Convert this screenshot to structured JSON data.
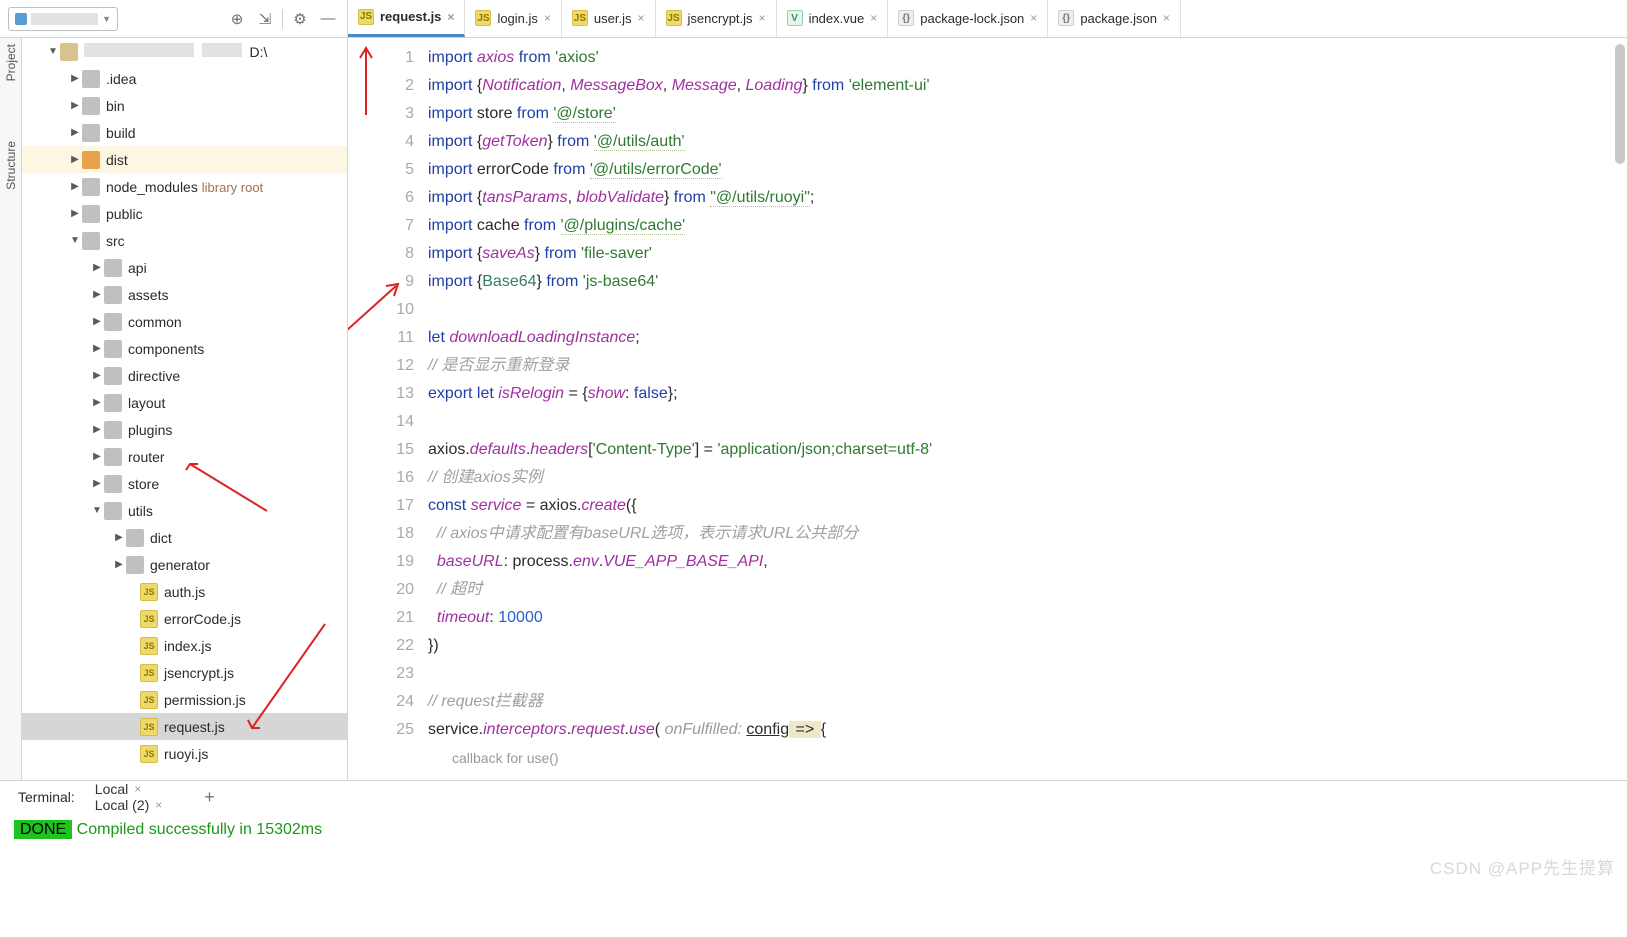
{
  "tabs": [
    {
      "name": "request.js",
      "type": "js",
      "active": true
    },
    {
      "name": "login.js",
      "type": "js"
    },
    {
      "name": "user.js",
      "type": "js"
    },
    {
      "name": "jsencrypt.js",
      "type": "js"
    },
    {
      "name": "index.vue",
      "type": "vue"
    },
    {
      "name": "package-lock.json",
      "type": "json"
    },
    {
      "name": "package.json",
      "type": "json"
    }
  ],
  "sideTabs": {
    "t0": "Project",
    "t1": "Structure"
  },
  "tree": {
    "root_suffix": "D:\\",
    "idea": ".idea",
    "bin": "bin",
    "build": "build",
    "dist": "dist",
    "node_modules": "node_modules",
    "node_modules_lib": "library root",
    "public": "public",
    "src": "src",
    "api": "api",
    "assets": "assets",
    "common": "common",
    "components": "components",
    "directive": "directive",
    "layout": "layout",
    "plugins": "plugins",
    "router": "router",
    "store": "store",
    "utils": "utils",
    "dict": "dict",
    "generator": "generator",
    "auth": "auth.js",
    "errorCode": "errorCode.js",
    "index": "index.js",
    "jsencrypt": "jsencrypt.js",
    "permission": "permission.js",
    "request": "request.js",
    "ruoyi": "ruoyi.js"
  },
  "code": {
    "lines": {
      "start": 1,
      "end": 25
    },
    "l1": {
      "a": "import ",
      "b": "axios",
      "c": " from ",
      "d": "'axios'"
    },
    "l2": {
      "a": "import ",
      "b": "{",
      "c": "Notification",
      "d": ", ",
      "e": "MessageBox",
      "f": ", ",
      "g": "Message",
      "h": ", ",
      "i": "Loading",
      "j": "} ",
      "k": "from ",
      "l": "'element-ui'"
    },
    "l3": {
      "a": "import ",
      "b": "store ",
      "c": "from ",
      "d": "'@/store'"
    },
    "l4": {
      "a": "import ",
      "b": "{",
      "c": "getToken",
      "d": "} ",
      "e": "from ",
      "f": "'@/utils/auth'"
    },
    "l5": {
      "a": "import ",
      "b": "errorCode ",
      "c": "from ",
      "d": "'@/utils/errorCode'"
    },
    "l6": {
      "a": "import ",
      "b": "{",
      "c": "tansParams",
      "d": ", ",
      "e": "blobValidate",
      "f": "} ",
      "g": "from ",
      "h": "\"@/utils/ruoyi\"",
      "i": ";"
    },
    "l7": {
      "a": "import ",
      "b": "cache ",
      "c": "from ",
      "d": "'@/plugins/cache'"
    },
    "l8": {
      "a": "import ",
      "b": "{",
      "c": "saveAs",
      "d": "} ",
      "e": "from ",
      "f": "'file-saver'"
    },
    "l9": {
      "a": "import ",
      "b": "{",
      "c": "Base64",
      "d": "} ",
      "e": "from ",
      "f": "'js-base64'"
    },
    "l11": {
      "a": "let ",
      "b": "downloadLoadingInstance",
      "c": ";"
    },
    "l12": "// 是否显示重新登录",
    "l13": {
      "a": "export let ",
      "b": "isRelogin ",
      "c": "= {",
      "d": "show",
      "e": ": ",
      "f": "false",
      "g": "};"
    },
    "l15": {
      "a": "axios.",
      "b": "defaults",
      "c": ".",
      "d": "headers",
      "e": "[",
      "f": "'Content-Type'",
      "g": "] = ",
      "h": "'application/json;charset=utf-8'"
    },
    "l16": "// 创建axios实例",
    "l17": {
      "a": "const ",
      "b": "service ",
      "c": "= axios.",
      "d": "create",
      "e": "({"
    },
    "l18": "  // axios中请求配置有baseURL选项，表示请求URL公共部分",
    "l19": {
      "a": "  baseURL",
      "b": ": process.",
      "c": "env",
      "d": ".",
      "e": "VUE_APP_BASE_API",
      "f": ","
    },
    "l20": "  // 超时",
    "l21": {
      "a": "  timeout",
      "b": ": ",
      "c": "10000"
    },
    "l22": "})",
    "l24": "// request拦截器",
    "l25": {
      "a": "service.",
      "b": "interceptors",
      "c": ".",
      "d": "request",
      "e": ".",
      "f": "use",
      "g": "( ",
      "h": "onFulfilled: ",
      "i": "config",
      "j": " => ",
      "k": "{"
    },
    "hint": "callback for use()"
  },
  "terminal": {
    "title": "Terminal:",
    "tabs": [
      {
        "label": "Local"
      },
      {
        "label": "Local (2)"
      }
    ],
    "done": "DONE",
    "msg": " Compiled successfully in 15302ms"
  },
  "watermark": "CSDN @APP先生提算"
}
